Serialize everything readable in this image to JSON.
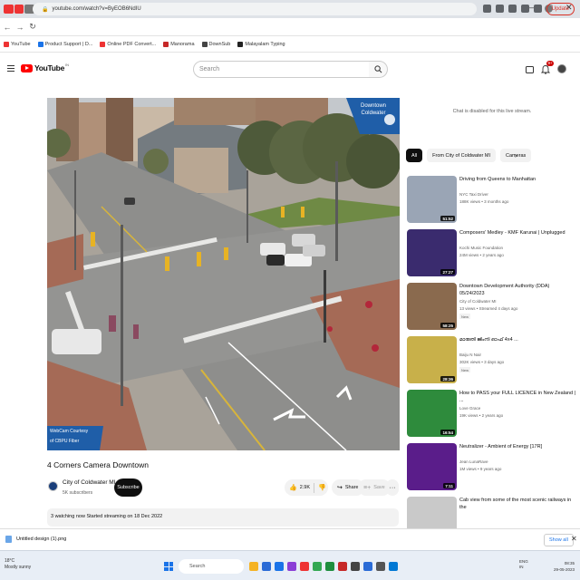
{
  "browser": {
    "tab_colors": [
      "#e33",
      "#e33",
      "#777",
      "#e33",
      "#777",
      "#1a73e8",
      "#777",
      "#e33",
      "#777",
      "#e33",
      "#777",
      "#e33",
      "#777",
      "#1a73e8",
      "#777",
      "#777",
      "#e33",
      "#777",
      "#777",
      "#777",
      "#1a73e8",
      "#777",
      "#777",
      "#e33",
      "#777",
      "#e33",
      "#777",
      "#777",
      "#e33",
      "#777",
      "#777",
      "#e33",
      "#777",
      "#34a853",
      "#777",
      "#34a853",
      "#a142f4",
      "#1a73e8",
      "#777",
      "#777",
      "#1a73e8",
      "#1a73e8",
      "#777"
    ],
    "address": "youtube.com/watch?v=ByEOB6NdIU",
    "update_label": "Update",
    "bookmarks": [
      {
        "label": "YouTube",
        "color": "#e33"
      },
      {
        "label": "Product Support | D...",
        "color": "#1a73e8"
      },
      {
        "label": "Online PDF Convert...",
        "color": "#e33"
      },
      {
        "label": "Manorama",
        "color": "#c62828"
      },
      {
        "label": "DownSub",
        "color": "#444"
      },
      {
        "label": "Malayalam Typing",
        "color": "#222"
      }
    ]
  },
  "youtube": {
    "logo_text": "YouTube",
    "country": "IN",
    "search_placeholder": "Search",
    "notification_count": "9+"
  },
  "video": {
    "overlay_logo": "Downtown Coldwater",
    "overlay_credit_line1": "WebCam Courtesy",
    "overlay_credit_line2": "of CBPU Fiber",
    "title": "4 Corners Camera Downtown",
    "channel": "City of Coldwater MI",
    "subscribers": "5K subscribers",
    "subscribe_label": "Subscribe",
    "likes": "2.9K",
    "share_label": "Share",
    "save_label": "Save",
    "more_label": "···",
    "description": "3 watching now  Started streaming on 18 Dec 2022"
  },
  "sidebar": {
    "chat_disabled": "Chat is disabled for this live stream.",
    "chips": [
      "All",
      "From City of Coldwater MI",
      "Cameras"
    ],
    "recommendations": [
      {
        "title": "Driving from Queens to Manhattan",
        "channel": "NYC Taxi Driver",
        "meta": "188K views • 3 months ago",
        "duration": "51:52",
        "badge": "",
        "thumb": "#9aa5b5"
      },
      {
        "title": "Composers' Medley - KMF Karunai | Unplugged",
        "channel": "Kochi Music Foundation",
        "meta": "24M views • 2 years ago",
        "duration": "27:27",
        "badge": "",
        "thumb": "#3a2b6e"
      },
      {
        "title": "Downtown Development Authority (DDA) 05/24/2023",
        "channel": "City of Coldwater MI",
        "meta": "13 views • Streamed 4 days ago",
        "duration": "58:25",
        "badge": "New",
        "thumb": "#8a6a4e"
      },
      {
        "title": "മാരുതി ജിംനി ഓഫ് 4x4 ...",
        "channel": "Baiju N Nair",
        "meta": "302K views • 3 days ago",
        "duration": "28:36",
        "badge": "New",
        "thumb": "#c8b04a"
      },
      {
        "title": "How to PASS your FULL LICENCE in New Zealand | ...",
        "channel": "Love Grace",
        "meta": "19K views • 2 years ago",
        "duration": "16:54",
        "badge": "",
        "thumb": "#2e8b3c"
      },
      {
        "title": "Neutralizer - Ambient of Energy [17R]",
        "channel": "Jean LunaRave",
        "meta": "1M views • 9 years ago",
        "duration": "7:11",
        "badge": "",
        "thumb": "#5a1d8a"
      },
      {
        "title": "Cab view from some of the most scenic railways in the",
        "channel": "",
        "meta": "",
        "duration": "",
        "badge": "",
        "thumb": "#c9c9c9"
      }
    ]
  },
  "downloads": {
    "file": "Untitled design (1).png",
    "show_all": "Show all"
  },
  "taskbar": {
    "temperature": "18°C",
    "weather": "Mostly sunny",
    "search_label": "Search",
    "language": "ENG",
    "region": "IN",
    "time": "08:35",
    "date": "29-05-2023",
    "app_colors": [
      "#f5b324",
      "#2a6bd6",
      "#1a73e8",
      "#8b3fd6",
      "#e33",
      "#34a853",
      "#1e8e3e",
      "#c62828",
      "#444",
      "#2a6bd6",
      "#555",
      "#0078d4"
    ]
  }
}
